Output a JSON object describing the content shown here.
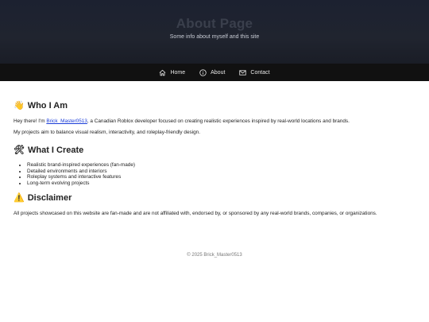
{
  "hero": {
    "title": "About Page",
    "subtitle": "Some info about myself and this site"
  },
  "nav": {
    "items": [
      {
        "icon": "home-icon",
        "label": "Home"
      },
      {
        "icon": "info-icon",
        "label": "About"
      },
      {
        "icon": "mail-icon",
        "label": "Contact"
      }
    ]
  },
  "who": {
    "emoji": "👋",
    "heading": "Who I Am",
    "intro_before": "Hey there! I'm ",
    "link_text": "Brick_Master0513",
    "intro_after": ", a Canadian Roblox developer focused on creating realistic experiences inspired by real-world locations and brands.",
    "para2": "My projects aim to balance visual realism, interactivity, and roleplay-friendly design."
  },
  "create": {
    "emoji": "🛠",
    "heading": "What I Create",
    "items": [
      "Realistic brand-inspired experiences (fan-made)",
      "Detailed environments and interiors",
      "Roleplay systems and interactive features",
      "Long-term evolving projects"
    ]
  },
  "disclaimer": {
    "emoji": "⚠️",
    "heading": "Disclaimer",
    "text": "All projects showcased on this website are fan-made and are not affiliated with, endorsed by, or sponsored by any real-world brands, companies, or organizations."
  },
  "footer": {
    "text": "© 2025 Brick_Master0513"
  },
  "colors": {
    "hero_bg": "#1c2130",
    "nav_bg": "#111111",
    "link": "#1a3cd8"
  }
}
